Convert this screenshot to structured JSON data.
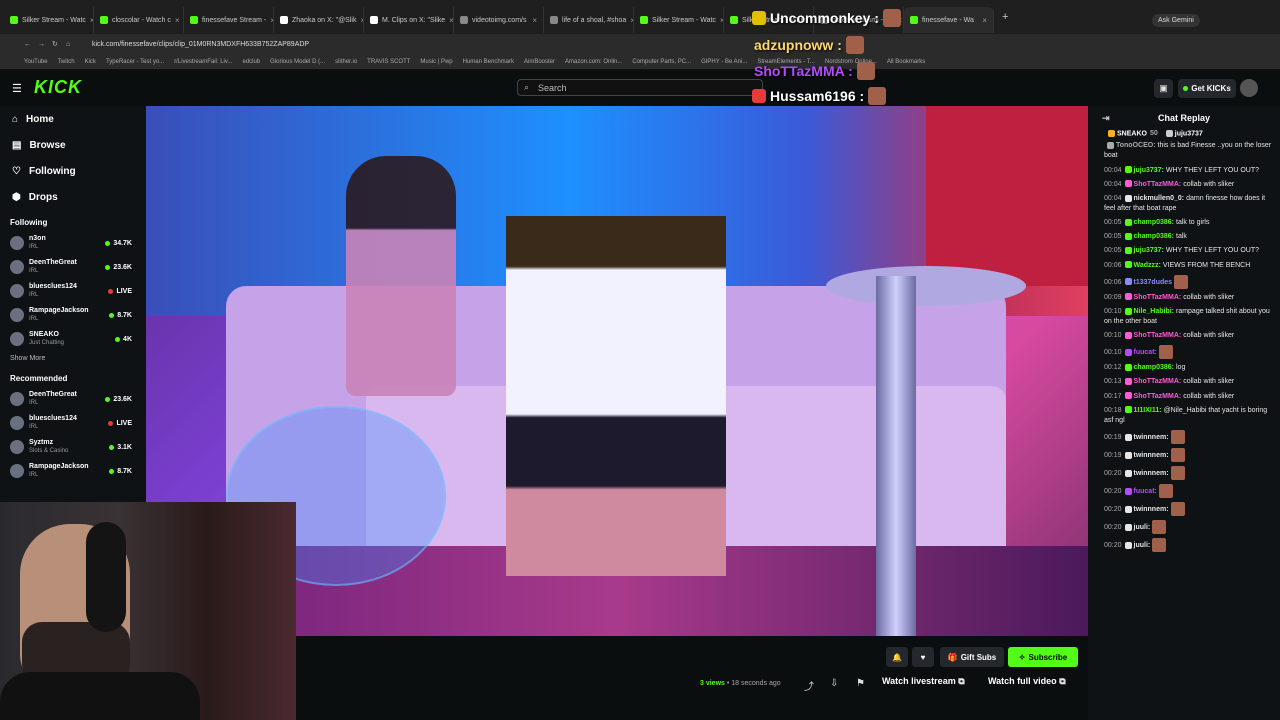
{
  "browser": {
    "tabs": [
      {
        "title": "Silker Stream - Watc",
        "color": "#53fc18"
      },
      {
        "title": "closcolar - Watch c",
        "color": "#53fc18"
      },
      {
        "title": "finessefave Stream -",
        "color": "#53fc18"
      },
      {
        "title": "Zhaoka on X: \"@Slik",
        "color": "#ffffff"
      },
      {
        "title": "M. Clips on X: \"Slike",
        "color": "#ffffff"
      },
      {
        "title": "videotoimg.com/s",
        "color": "#888888"
      },
      {
        "title": "life of a shoal, #shoa",
        "color": "#888888"
      },
      {
        "title": "Silker Stream - Watc",
        "color": "#53fc18"
      },
      {
        "title": "Silker Stream - Watc",
        "color": "#53fc18"
      },
      {
        "title": "hotels in miami - Se",
        "color": "#888888"
      },
      {
        "title": "finessefave - Wa",
        "color": "#53fc18"
      }
    ],
    "ask_gemini": "Ask Gemini",
    "url": "kick.com/finessefave/clips/clip_01M0RN3MDXFH633B752ZAP89ADP",
    "bookmarks": [
      "YouTube",
      "Twitch",
      "Kick",
      "TypeRacer - Test yo...",
      "r/LivestreamFail: Liv...",
      "edclub",
      "Glorious Model D (...",
      "slither.io",
      "TRAVIS SCOTT",
      "Music | Pwp",
      "Human Benchmark",
      "AimBooster",
      "Amazon.com: Onlin...",
      "Computer Parts, PC...",
      "GIPHY - Be Ani...",
      "StreamElements - T...",
      "Nordstrom Online...",
      "All Bookmarks"
    ]
  },
  "overlay_chat": [
    {
      "user": "Uncommonkey :",
      "color": "#ffffff"
    },
    {
      "user": "adzupnoww :",
      "color": "#ffd86b"
    },
    {
      "user": "ShoTTazMMA :",
      "color": "#b44bff"
    },
    {
      "user": "Hussam6196 :",
      "color": "#ffffff"
    }
  ],
  "header": {
    "logo": "KICK",
    "search_placeholder": "Search",
    "get_kicks": "Get KICKs"
  },
  "sidebar": {
    "nav": [
      {
        "label": "Home",
        "icon": "⌂"
      },
      {
        "label": "Browse",
        "icon": "▤"
      },
      {
        "label": "Following",
        "icon": "♡"
      },
      {
        "label": "Drops",
        "icon": "⬢"
      }
    ],
    "following_title": "Following",
    "following": [
      {
        "name": "n3on",
        "category": "IRL",
        "viewers": "34.7K"
      },
      {
        "name": "DeenTheGreat",
        "category": "IRL",
        "viewers": "23.6K"
      },
      {
        "name": "bluesclues124",
        "category": "IRL",
        "viewers": "LIVE"
      },
      {
        "name": "RampageJackson",
        "category": "IRL",
        "viewers": "8.7K"
      },
      {
        "name": "SNEAKO",
        "category": "Just Chatting",
        "viewers": "4K"
      }
    ],
    "show_more": "Show More",
    "recommended_title": "Recommended",
    "recommended": [
      {
        "name": "DeenTheGreat",
        "category": "IRL",
        "viewers": "23.6K"
      },
      {
        "name": "bluesclues124",
        "category": "IRL",
        "viewers": "LIVE"
      },
      {
        "name": "Syztmz",
        "category": "Slots & Casino",
        "viewers": "3.1K"
      },
      {
        "name": "RampageJackson",
        "category": "IRL",
        "viewers": "8.7K"
      }
    ]
  },
  "player": {
    "gift_subs": "Gift Subs",
    "subscribe": "Subscribe",
    "views": "3 views",
    "posted": "• 18 seconds ago",
    "watch_livestream": "Watch livestream",
    "watch_full_video": "Watch full video"
  },
  "chat": {
    "title": "Chat Replay",
    "pinned": [
      {
        "user": "SNEAKO",
        "count": "50"
      },
      {
        "user": "juju3737",
        "count": ""
      }
    ],
    "messages": [
      {
        "time": "",
        "user": "TonoOCEO:",
        "color": "#aaaaaa",
        "text": "this is bad Finesse ..you on the loser boat"
      },
      {
        "time": "00:04",
        "user": "juju3737:",
        "color": "#53fc18",
        "text": "WHY THEY LEFT YOU OUT?"
      },
      {
        "time": "00:04",
        "user": "ShoTTazMMA:",
        "color": "#ff5ad8",
        "text": "collab with sliker"
      },
      {
        "time": "00:04",
        "user": "nickmullen0_0:",
        "color": "#e6e6e6",
        "text": "damn finesse how does it feel after that boat rape"
      },
      {
        "time": "00:05",
        "user": "champ0386:",
        "color": "#53fc18",
        "text": "talk to girls"
      },
      {
        "time": "00:05",
        "user": "champ0386:",
        "color": "#53fc18",
        "text": "talk"
      },
      {
        "time": "00:05",
        "user": "juju3737:",
        "color": "#53fc18",
        "text": "WHY THEY LEFT YOU OUT?"
      },
      {
        "time": "00:06",
        "user": "Wadzzz:",
        "color": "#53fc18",
        "text": "VIEWS FROM THE BENCH"
      },
      {
        "time": "00:06",
        "user": "t1337dudes",
        "color": "#8a8aff",
        "text": ""
      },
      {
        "time": "00:09",
        "user": "ShoTTazMMA:",
        "color": "#ff5ad8",
        "text": "collab with sliker"
      },
      {
        "time": "00:10",
        "user": "Nile_Habibi:",
        "color": "#53fc18",
        "text": "rampage talked shit about you on the other boat"
      },
      {
        "time": "00:10",
        "user": "ShoTTazMMA:",
        "color": "#ff5ad8",
        "text": "collab with sliker"
      },
      {
        "time": "00:10",
        "user": "fuucat:",
        "color": "#b44bff",
        "text": ""
      },
      {
        "time": "00:12",
        "user": "champ0386:",
        "color": "#53fc18",
        "text": "log"
      },
      {
        "time": "00:13",
        "user": "ShoTTazMMA:",
        "color": "#ff5ad8",
        "text": "collab with sliker"
      },
      {
        "time": "00:17",
        "user": "ShoTTazMMA:",
        "color": "#ff5ad8",
        "text": "collab with sliker"
      },
      {
        "time": "00:18",
        "user": "1I1IXI11:",
        "color": "#53fc18",
        "text": "@Nile_Habibi that yacht is boring asf ngl"
      },
      {
        "time": "00:19",
        "user": "twinnnem:",
        "color": "#e6e6e6",
        "text": ""
      },
      {
        "time": "00:19",
        "user": "twinnnem:",
        "color": "#e6e6e6",
        "text": ""
      },
      {
        "time": "00:20",
        "user": "twinnnem:",
        "color": "#e6e6e6",
        "text": ""
      },
      {
        "time": "00:20",
        "user": "fuucat:",
        "color": "#b44bff",
        "text": ""
      },
      {
        "time": "00:20",
        "user": "twinnnem:",
        "color": "#e6e6e6",
        "text": ""
      },
      {
        "time": "00:20",
        "user": "juuli:",
        "color": "#e6e6e6",
        "text": ""
      },
      {
        "time": "00:20",
        "user": "juuli:",
        "color": "#e6e6e6",
        "text": ""
      }
    ]
  },
  "colors": {
    "accent": "#53fc18",
    "background": "#0b0e0f",
    "panel": "#0f1214"
  }
}
